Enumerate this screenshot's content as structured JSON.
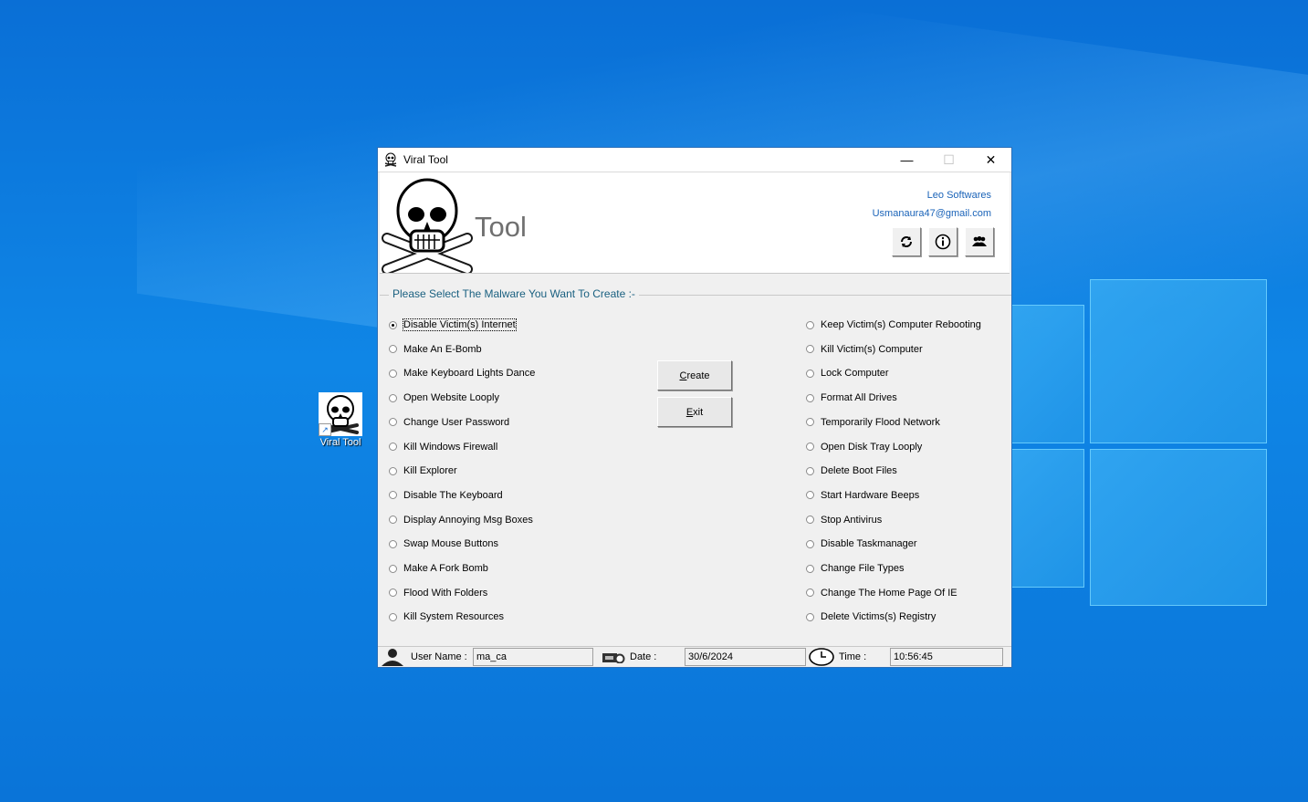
{
  "desktop": {
    "icons": [
      {
        "label": "Viral Tool",
        "icon": "skull-crossbones-icon",
        "shortcut": true
      }
    ]
  },
  "window": {
    "title": "Viral Tool",
    "controls": {
      "minimize": "—",
      "maximize": "☐",
      "close": "✕"
    },
    "header": {
      "logo_text": "Tool",
      "company": "Leo Softwares",
      "email": "Usmanaura47@gmail.com",
      "buttons": [
        {
          "name": "refresh",
          "icon": "refresh-icon"
        },
        {
          "name": "info",
          "icon": "info-icon"
        },
        {
          "name": "users",
          "icon": "users-icon"
        }
      ]
    },
    "group_title": "Please Select The Malware You Want To Create :-",
    "left_options": [
      "Disable Victim(s) Internet",
      "Make An E-Bomb",
      "Make Keyboard Lights Dance",
      "Open Website Looply",
      "Change User Password",
      "Kill Windows Firewall",
      "Kill Explorer",
      "Disable The Keyboard",
      "Display Annoying Msg Boxes",
      "Swap Mouse Buttons",
      "Make A Fork Bomb",
      "Flood With Folders",
      "Kill System Resources"
    ],
    "right_options": [
      "Keep Victim(s) Computer Rebooting",
      "Kill Victim(s) Computer",
      "Lock Computer",
      "Format All Drives",
      "Temporarily Flood Network",
      "Open Disk Tray Looply",
      "Delete Boot Files",
      "Start Hardware Beeps",
      "Stop Antivirus",
      "Disable Taskmanager",
      "Change File Types",
      "Change The Home Page Of IE",
      "Delete Victims(s) Registry"
    ],
    "selected_option": "Disable Victim(s) Internet",
    "create_button": {
      "accel": "C",
      "rest": "reate"
    },
    "exit_button": {
      "accel": "E",
      "rest": "xit"
    },
    "status": {
      "user_label": "User Name :",
      "user_value": "ma_ca",
      "date_label": "Date :",
      "date_value": "30/6/2024",
      "time_label": "Time :",
      "time_value": "10:56:45"
    }
  }
}
